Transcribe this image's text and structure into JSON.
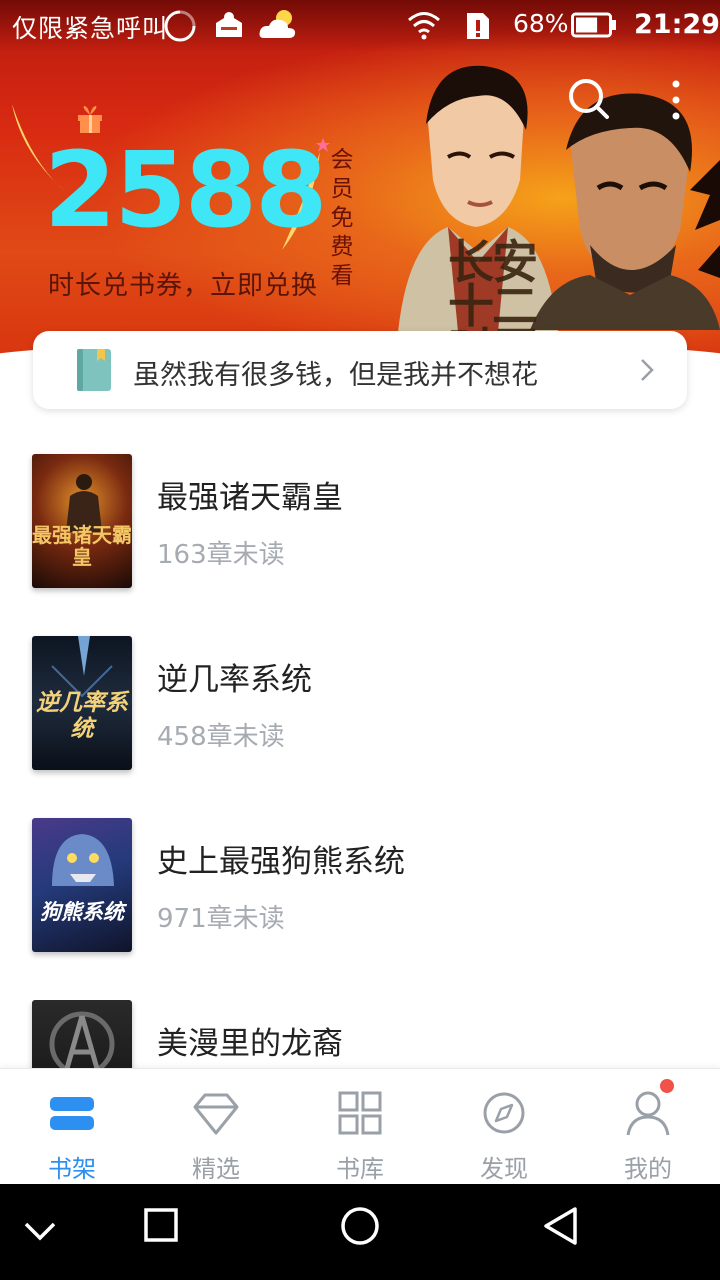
{
  "status_bar": {
    "carrier_text": "仅限紧急呼叫",
    "battery_percent": "68%",
    "time": "21:29",
    "battery_level": 0.68
  },
  "banner": {
    "promo_number": "2588",
    "promo_subtitle": "时长兑书券，立即兑换",
    "promo_vertical": "会员免费看",
    "movie_title": "长安十二时辰",
    "colors": {
      "accent": "#3fe6f5",
      "background": "#d82a12"
    }
  },
  "notice": {
    "text": "虽然我有很多钱，但是我并不想花"
  },
  "books": [
    {
      "title": "最强诸天霸皇",
      "unread": "163章未读",
      "cover_text": "最强诸天霸皇"
    },
    {
      "title": "逆几率系统",
      "unread": "458章未读",
      "cover_text": "逆几率系统"
    },
    {
      "title": "史上最强狗熊系统",
      "unread": "971章未读",
      "cover_text": "狗熊系统"
    },
    {
      "title": "美漫里的龙裔",
      "unread": ""
    }
  ],
  "tabs": [
    {
      "label": "书架",
      "icon": "bookshelf-icon",
      "active": true
    },
    {
      "label": "精选",
      "icon": "diamond-icon",
      "active": false
    },
    {
      "label": "书库",
      "icon": "grid-icon",
      "active": false
    },
    {
      "label": "发现",
      "icon": "compass-icon",
      "active": false
    },
    {
      "label": "我的",
      "icon": "person-icon",
      "active": false
    }
  ],
  "theme": {
    "active_tab": "#2d8ff0",
    "inactive_tab": "#9aa0a8",
    "badge": "#f0524a"
  }
}
